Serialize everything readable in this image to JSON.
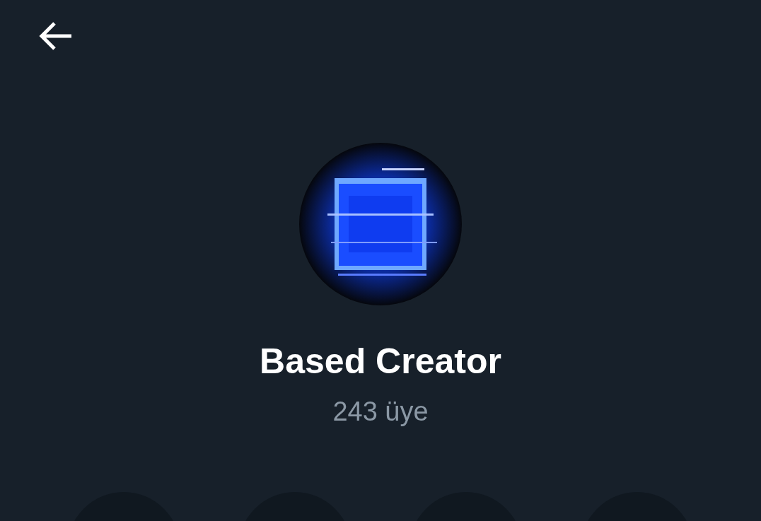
{
  "community": {
    "name": "Based Creator",
    "members": "243 üye"
  }
}
